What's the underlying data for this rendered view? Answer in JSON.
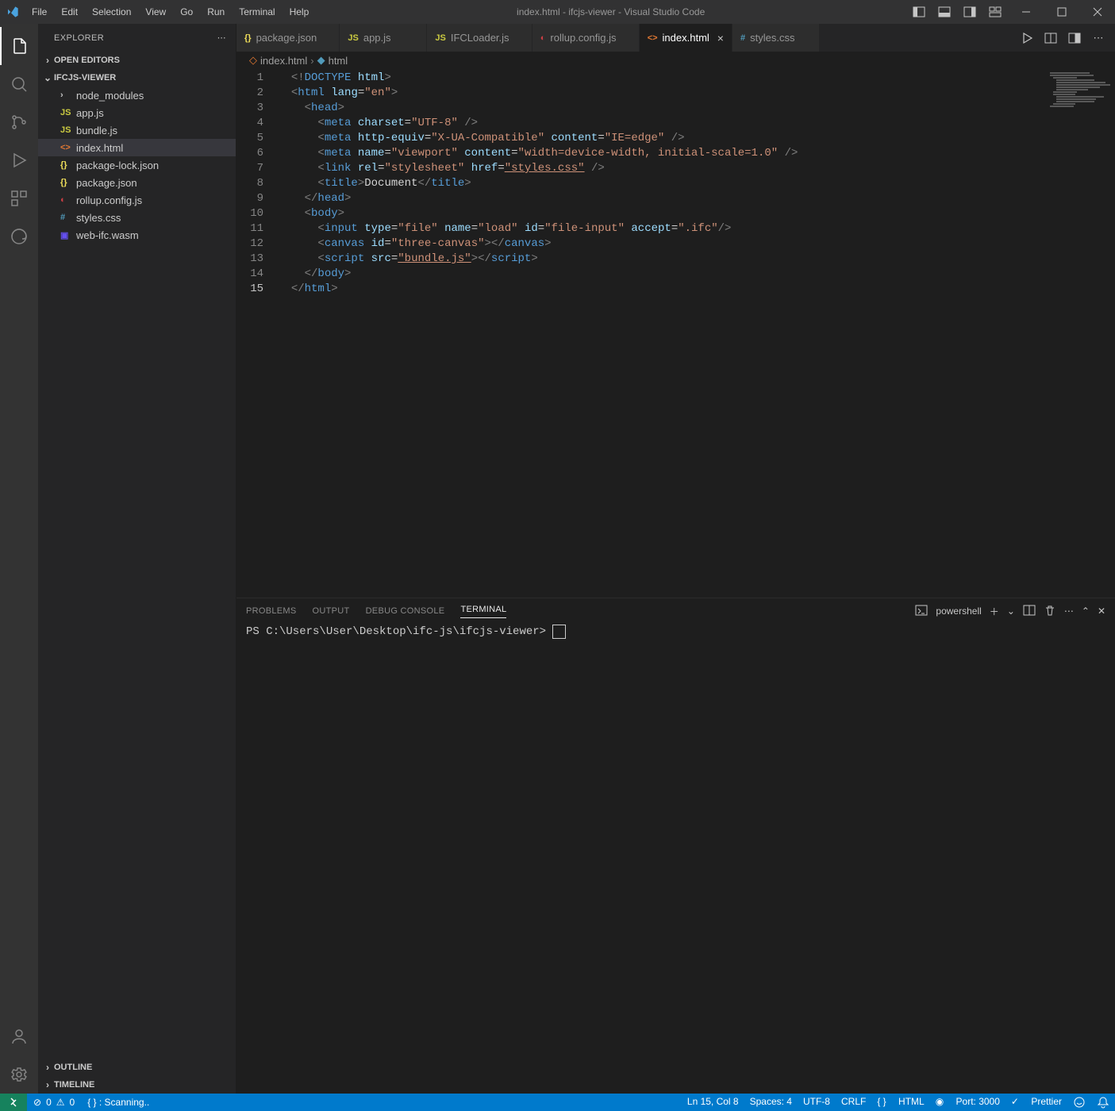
{
  "titlebar": {
    "menus": [
      "File",
      "Edit",
      "Selection",
      "View",
      "Go",
      "Run",
      "Terminal",
      "Help"
    ],
    "title": "index.html - ifcjs-viewer - Visual Studio Code"
  },
  "sidebar": {
    "title": "EXPLORER",
    "sections": {
      "openEditors": "OPEN EDITORS",
      "project": "IFCJS-VIEWER",
      "outline": "OUTLINE",
      "timeline": "TIMELINE"
    },
    "files": [
      {
        "name": "node_modules",
        "type": "folder"
      },
      {
        "name": "app.js",
        "type": "js"
      },
      {
        "name": "bundle.js",
        "type": "js"
      },
      {
        "name": "index.html",
        "type": "html",
        "selected": true
      },
      {
        "name": "package-lock.json",
        "type": "json"
      },
      {
        "name": "package.json",
        "type": "json"
      },
      {
        "name": "rollup.config.js",
        "type": "cfg"
      },
      {
        "name": "styles.css",
        "type": "css"
      },
      {
        "name": "web-ifc.wasm",
        "type": "wasm"
      }
    ]
  },
  "tabs": [
    {
      "label": "package.json",
      "icon": "json"
    },
    {
      "label": "app.js",
      "icon": "js"
    },
    {
      "label": "IFCLoader.js",
      "icon": "js"
    },
    {
      "label": "rollup.config.js",
      "icon": "cfg"
    },
    {
      "label": "index.html",
      "icon": "html",
      "active": true
    },
    {
      "label": "styles.css",
      "icon": "css"
    }
  ],
  "breadcrumb": {
    "file": "index.html",
    "symbol": "html"
  },
  "code": {
    "lines": 15,
    "currentLine": 15,
    "l1_doctype": "DOCTYPE",
    "l1_html": "html",
    "l2_tag": "html",
    "l2_attr": "lang",
    "l2_val": "\"en\"",
    "l3_tag": "head",
    "l4_tag": "meta",
    "l4_attr": "charset",
    "l4_val": "\"UTF-8\"",
    "l5_tag": "meta",
    "l5_a1": "http-equiv",
    "l5_v1": "\"X-UA-Compatible\"",
    "l5_a2": "content",
    "l5_v2": "\"IE=edge\"",
    "l6_tag": "meta",
    "l6_a1": "name",
    "l6_v1": "\"viewport\"",
    "l6_a2": "content",
    "l6_v2": "\"width=device-width, initial-scale=1.0\"",
    "l7_tag": "link",
    "l7_a1": "rel",
    "l7_v1": "\"stylesheet\"",
    "l7_a2": "href",
    "l7_v2": "\"styles.css\"",
    "l8_tag": "title",
    "l8_txt": "Document",
    "l9_tag": "head",
    "l10_tag": "body",
    "l11_tag": "input",
    "l11_a1": "type",
    "l11_v1": "\"file\"",
    "l11_a2": "name",
    "l11_v2": "\"load\"",
    "l11_a3": "id",
    "l11_v3": "\"file-input\"",
    "l11_a4": "accept",
    "l11_v4": "\".ifc\"",
    "l12_tag": "canvas",
    "l12_a1": "id",
    "l12_v1": "\"three-canvas\"",
    "l13_tag": "script",
    "l13_a1": "src",
    "l13_v1": "\"bundle.js\"",
    "l14_tag": "body",
    "l15_tag": "html"
  },
  "panel": {
    "tabs": [
      "PROBLEMS",
      "OUTPUT",
      "DEBUG CONSOLE",
      "TERMINAL"
    ],
    "active": "TERMINAL",
    "shell_label": "powershell",
    "prompt": "PS C:\\Users\\User\\Desktop\\ifc-js\\ifcjs-viewer> "
  },
  "statusbar": {
    "errors": "0",
    "warnings": "0",
    "scanning": "{ } : Scanning..",
    "lncol": "Ln 15, Col 8",
    "spaces": "Spaces: 4",
    "encoding": "UTF-8",
    "eol": "CRLF",
    "lang": "HTML",
    "port": "Port: 3000",
    "prettier": "Prettier"
  }
}
